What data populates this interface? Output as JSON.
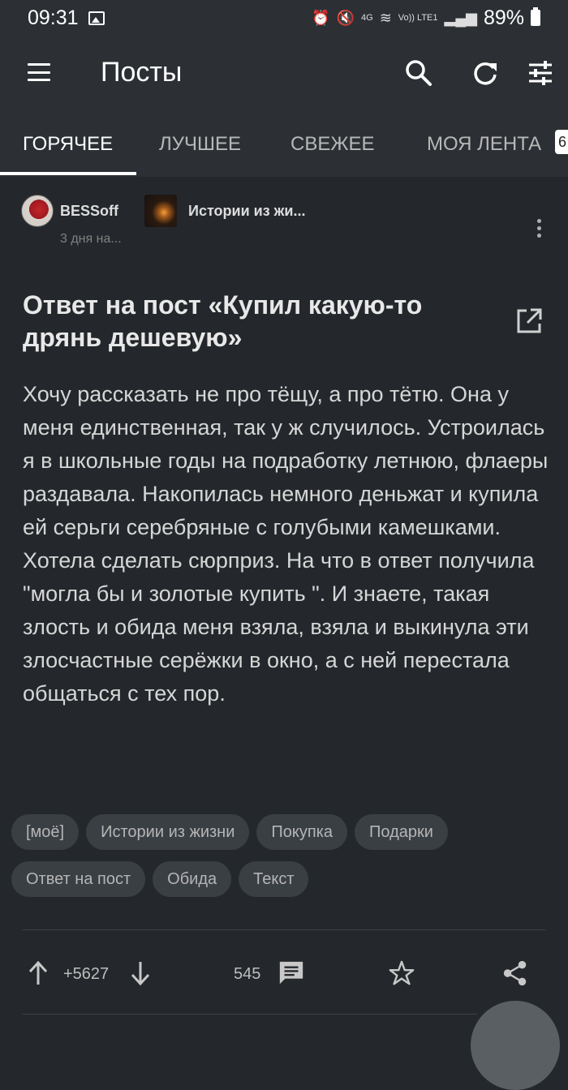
{
  "status_bar": {
    "time": "09:31",
    "network": "4G",
    "volte": "Vo)) LTE1",
    "battery": "89%"
  },
  "app_bar": {
    "title": "Посты",
    "actions": [
      "search-icon",
      "refresh-icon",
      "filter-sliders-icon"
    ]
  },
  "tabs": [
    {
      "label": "ГОРЯЧЕЕ",
      "active": true
    },
    {
      "label": "ЛУЧШЕЕ",
      "active": false
    },
    {
      "label": "СВЕЖЕЕ",
      "active": false
    },
    {
      "label": "МОЯ ЛЕНТА",
      "active": false
    }
  ],
  "tab_badge": "6",
  "post": {
    "author": "BESSoff",
    "time": "3 дня на...",
    "community": "Истории из жи...",
    "title": "Ответ на пост «Купил какую-то дрянь дешевую»",
    "body": "Хочу рассказать не про тёщу, а про тётю. Она у меня единственная, так у ж случилось. Устроилась я в школьные годы на подработку летнюю, флаеры раздавала. Накопилась немного деньжат и купила ей серьги серебряные с голубыми камешками. Хотела сделать сюрприз. На что в ответ получила \"могла бы и золотые купить \". И знаете, такая злость и обида меня взяла, взяла и выкинула эти злосчастные серёжки в окно, а с ней перестала общаться с тех пор.",
    "tags": [
      "[моё]",
      "Истории из жизни",
      "Покупка",
      "Подарки",
      "Ответ на пост",
      "Обида",
      "Текст"
    ],
    "rating": "+5627",
    "comments": "545"
  },
  "colors": {
    "background": "#24282c",
    "app_bar": "#2c3034",
    "tag_background": "#3a3f44",
    "text": "#e6e6e6"
  }
}
